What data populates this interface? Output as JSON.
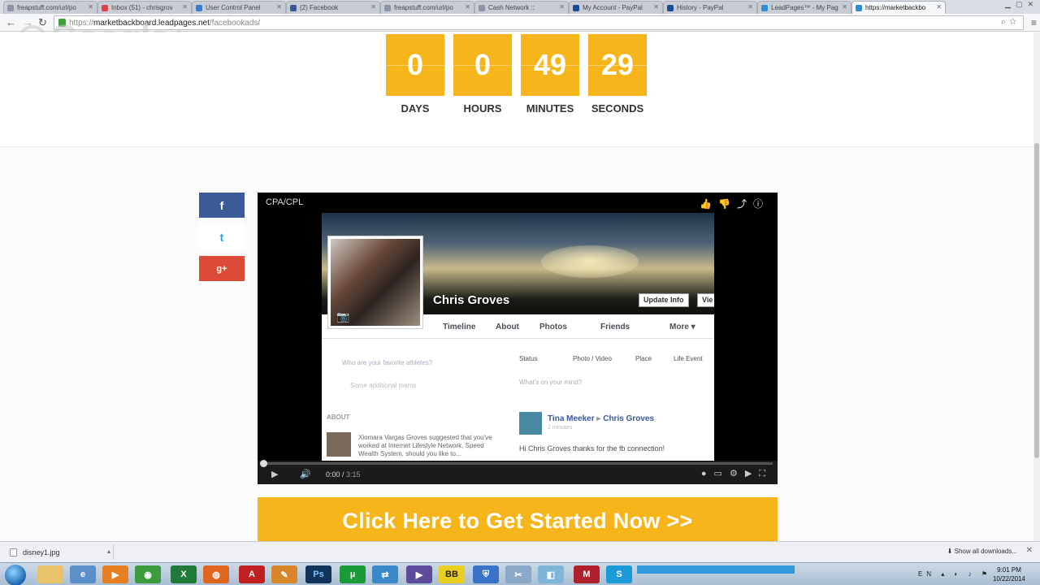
{
  "browser": {
    "tabs": [
      {
        "label": "freapstuff.com/url/po"
      },
      {
        "label": "Inbox (51) - chrisgrov"
      },
      {
        "label": "User Control Panel"
      },
      {
        "label": "(2) Facebook"
      },
      {
        "label": "freapstuff.com/url/po"
      },
      {
        "label": "Cash Network ::"
      },
      {
        "label": "My Account - PayPal"
      },
      {
        "label": "History - PayPal"
      },
      {
        "label": "LeadPages™ - My Pag"
      },
      {
        "label": "https://marketbackbo"
      }
    ],
    "url_scheme": "https://",
    "url_host": "marketbackboard.leadpages.net",
    "url_path": "/facebookads/",
    "overlay_text": "Google+"
  },
  "countdown": {
    "days": {
      "value": "0",
      "label": "DAYS"
    },
    "hours": {
      "value": "0",
      "label": "HOURS"
    },
    "minutes": {
      "value": "49",
      "label": "MINUTES"
    },
    "seconds": {
      "value": "29",
      "label": "SECONDS"
    },
    "color": "#f5b51b"
  },
  "share": {
    "facebook": "f",
    "twitter": "t",
    "googleplus": "g+"
  },
  "video": {
    "title": "CPA/CPL",
    "current_time": "0:00",
    "duration": "3:15",
    "progress_percent": 0,
    "facebook_profile": {
      "name": "Chris Groves",
      "update_info": "Update Info",
      "view_btn": "Vie",
      "nav": [
        "Timeline",
        "About",
        "Photos",
        "Friends",
        "More ▾"
      ],
      "left_question": "Who are your favorite athletes?",
      "left_sub": "Some additional teams",
      "about_heading": "ABOUT",
      "suggestion": "Xiomara Vargas Groves suggested that you've worked at Internet Lifestyle Network, Speed Wealth System, should you like to...",
      "actions": [
        "Status",
        "Photo / Video",
        "Place",
        "Life Event"
      ],
      "whats_on_mind": "What's on your mind?",
      "post_author": "Tina Meeker",
      "post_target": "Chris Groves",
      "post_time": "2 minutes",
      "post_text": "Hi Chris Groves thanks for the fb connection!"
    }
  },
  "cta": {
    "label": "Click Here to Get Started Now >>",
    "color": "#f5b51b"
  },
  "downloads": {
    "file": "disney1.jpg",
    "show_all": "Show all downloads..."
  },
  "taskbar": {
    "apps": [
      "folder",
      "explorer",
      "media",
      "chrome",
      "excel",
      "firefox",
      "acrobat",
      "paint",
      "photoshop",
      "utorrent",
      "network",
      "visualstudio",
      "bestbuy",
      "security",
      "tools",
      "app",
      "mcafee",
      "skype"
    ],
    "language": "EN",
    "time": "9:01 PM",
    "date": "10/22/2014"
  }
}
